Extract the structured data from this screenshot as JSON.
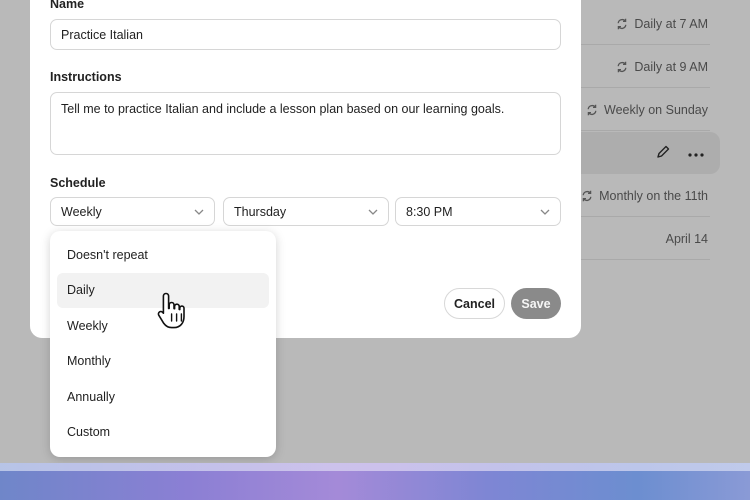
{
  "background_list": [
    {
      "schedule": "Daily at 7 AM",
      "icon": "repeat-icon"
    },
    {
      "schedule": "Daily at 9 AM",
      "icon": "repeat-icon"
    },
    {
      "schedule": "Weekly on Sunday",
      "icon": "repeat-icon"
    },
    {
      "schedule": "",
      "icons": [
        "pencil-icon",
        "more-icon"
      ],
      "highlighted": true
    },
    {
      "schedule": "Monthly on the 11th",
      "icon": "repeat-icon"
    },
    {
      "schedule": "April 14"
    }
  ],
  "form": {
    "name_label": "Name",
    "name_value": "Practice Italian",
    "instructions_label": "Instructions",
    "instructions_value": "Tell me to practice Italian and include a lesson plan based on our learning goals.",
    "schedule_label": "Schedule",
    "frequency_value": "Weekly",
    "day_value": "Thursday",
    "time_value": "8:30 PM",
    "cancel_label": "Cancel",
    "save_label": "Save"
  },
  "dropdown": {
    "options": [
      "Doesn't repeat",
      "Daily",
      "Weekly",
      "Monthly",
      "Annually",
      "Custom"
    ],
    "hovered": "Daily"
  },
  "colors": {
    "save_button": "#8a8a8a",
    "overlay": "#b9b9b9",
    "hover": "#f2f2f2"
  }
}
